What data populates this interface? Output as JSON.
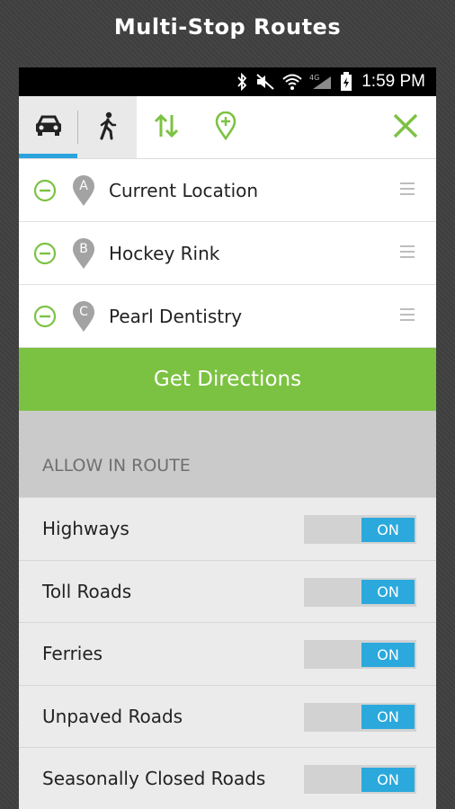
{
  "promo": {
    "title": "Multi-Stop Routes"
  },
  "status_bar": {
    "time": "1:59 PM",
    "network": "4G"
  },
  "toolbar": {
    "modes": [
      {
        "name": "car",
        "icon": "car-icon",
        "active": true
      },
      {
        "name": "walk",
        "icon": "walking-person-icon",
        "active": false
      }
    ],
    "tools": [
      "swap-arrows-icon",
      "add-location-icon"
    ],
    "close_icon": "close-icon",
    "accent": "#7cc242",
    "active_tab_color": "#2aa3de"
  },
  "stops": [
    {
      "letter": "A",
      "label": "Current Location"
    },
    {
      "letter": "B",
      "label": "Hockey Rink"
    },
    {
      "letter": "C",
      "label": "Pearl Dentistry"
    }
  ],
  "directions_button": {
    "label": "Get Directions",
    "color": "#7cc242"
  },
  "allow_section": {
    "header": "ALLOW IN ROUTE",
    "options": [
      {
        "label": "Highways",
        "state": "ON"
      },
      {
        "label": "Toll Roads",
        "state": "ON"
      },
      {
        "label": "Ferries",
        "state": "ON"
      },
      {
        "label": "Unpaved Roads",
        "state": "ON"
      },
      {
        "label": "Seasonally Closed Roads",
        "state": "ON"
      }
    ],
    "toggle_on_color": "#2ba9dc"
  }
}
